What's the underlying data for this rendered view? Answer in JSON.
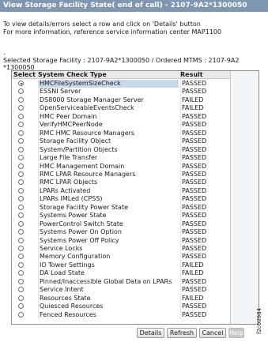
{
  "window": {
    "title": "View Storage Facility State( end of call) - 2107-9A2*1300050"
  },
  "instructions": {
    "line1": "To view details/errors select a row and click on 'Details' button",
    "line2": "For more information, reference service information center MAP1100"
  },
  "separator": ".",
  "facility": {
    "line1": "Selected Storage Facility : 2107-9A2*1300050 / Ordered MTMS : 2107-9A2",
    "line2": "*1300050"
  },
  "table": {
    "headers": {
      "select": "Select",
      "type": "System Check Type",
      "result": "Result"
    },
    "rows": [
      {
        "type": "HMCFileSystemSizeCheck",
        "result": "PASSED",
        "selected": true
      },
      {
        "type": "ESSNI Server",
        "result": "PASSED"
      },
      {
        "type": "DS8000 Storage Manager Server",
        "result": "FAILED"
      },
      {
        "type": "OpenServiceableEventsCheck",
        "result": "FAILED"
      },
      {
        "type": "HMC Peer Domain",
        "result": "PASSED"
      },
      {
        "type": "VerifyHMCPeerNode",
        "result": "PASSED"
      },
      {
        "type": "RMC HMC Resource Managers",
        "result": "PASSED"
      },
      {
        "type": "Storage Facility Object",
        "result": "PASSED"
      },
      {
        "type": "System/Partition Objects",
        "result": "PASSED"
      },
      {
        "type": "Large File Transfer",
        "result": "PASSED"
      },
      {
        "type": "HMC Management Domain",
        "result": "PASSED"
      },
      {
        "type": "RMC LPAR Resource Managers",
        "result": "PASSED"
      },
      {
        "type": "RMC LPAR Objects",
        "result": "PASSED"
      },
      {
        "type": "LPARs Activated",
        "result": "PASSED"
      },
      {
        "type": "LPARs IMLed (CPSS)",
        "result": "PASSED"
      },
      {
        "type": "Storage Facility Power State",
        "result": "PASSED"
      },
      {
        "type": "Systems Power State",
        "result": "PASSED"
      },
      {
        "type": "PowerControl Switch State",
        "result": "PASSED"
      },
      {
        "type": "Systems Power On Option",
        "result": "PASSED"
      },
      {
        "type": "Systems Power Off Policy",
        "result": "PASSED"
      },
      {
        "type": "Service Locks",
        "result": "PASSED"
      },
      {
        "type": "Memory Configuration",
        "result": "PASSED"
      },
      {
        "type": "IO Tower Settings",
        "result": "FAILED"
      },
      {
        "type": "DA Load State",
        "result": "FAILED"
      },
      {
        "type": "Pinned/Inaccessible Global Data on LPARs",
        "result": "PASSED"
      },
      {
        "type": "Service Intent",
        "result": "PASSED"
      },
      {
        "type": "Resources State",
        "result": "FAILED"
      },
      {
        "type": "Quiesced Resources",
        "result": "PASSED"
      },
      {
        "type": "Fenced Resources",
        "result": "PASSED"
      }
    ]
  },
  "buttons": {
    "details": "Details",
    "refresh": "Refresh",
    "cancel": "Cancel",
    "help": "Help"
  },
  "figure_id": "f2c00984",
  "colors": {
    "title_bar": "#7f97b2",
    "selected_row": "#c9d9ec"
  }
}
